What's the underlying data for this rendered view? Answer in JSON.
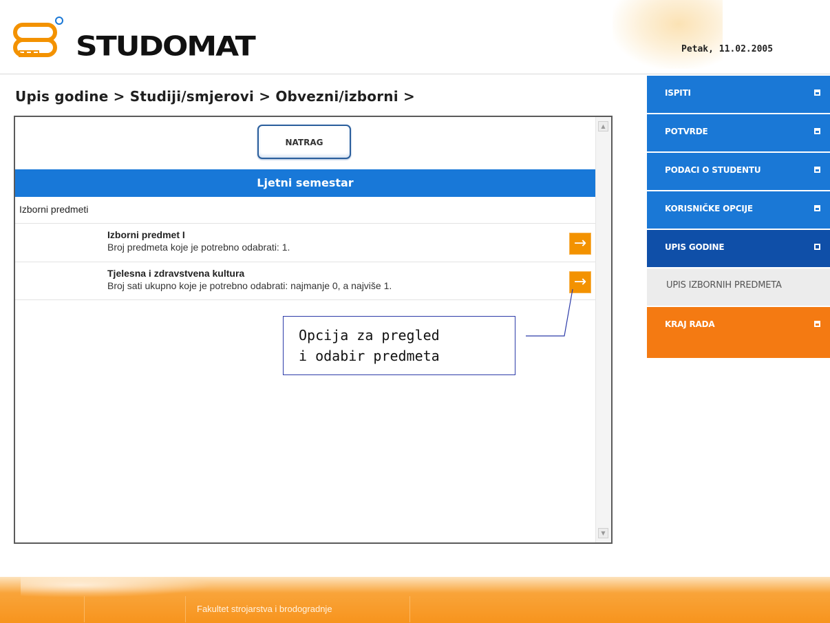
{
  "header": {
    "logo_text": "STUDOMAT",
    "date": "Petak, 11.02.2005"
  },
  "breadcrumb": "Upis godine > Studiji/smjerovi > Obvezni/izborni >",
  "content": {
    "back_button": "NATRAG",
    "semester_title": "Ljetni semestar",
    "group_title": "Izborni predmeti",
    "rows": [
      {
        "title": "Izborni predmet I",
        "description": "Broj predmeta koje je potrebno odabrati: 1.",
        "action_icon": "arrow-right-icon"
      },
      {
        "title": "Tjelesna i zdravstvena kultura",
        "description": "Broj sati ukupno koje je potrebno odabrati: najmanje 0, a najviše 1.",
        "action_icon": "arrow-right-icon"
      }
    ]
  },
  "callout": {
    "line1": "Opcija za pregled",
    "line2": "i odabir predmeta"
  },
  "nav": {
    "items": [
      {
        "label": "ISPITI"
      },
      {
        "label": "POTVRDE"
      },
      {
        "label": "PODACI O STUDENTU"
      },
      {
        "label": "KORISNIČKE OPCIJE"
      },
      {
        "label": "UPIS GODINE"
      },
      {
        "label": "UPIS IZBORNIH PREDMETA"
      },
      {
        "label": "KRAJ RADA"
      }
    ]
  },
  "footer": {
    "faculty": "Fakultet strojarstva i brodogradnje"
  },
  "colors": {
    "primary_blue": "#1a78d6",
    "active_blue": "#0f4fa8",
    "orange": "#f47a12",
    "arrow_orange": "#f39200"
  }
}
